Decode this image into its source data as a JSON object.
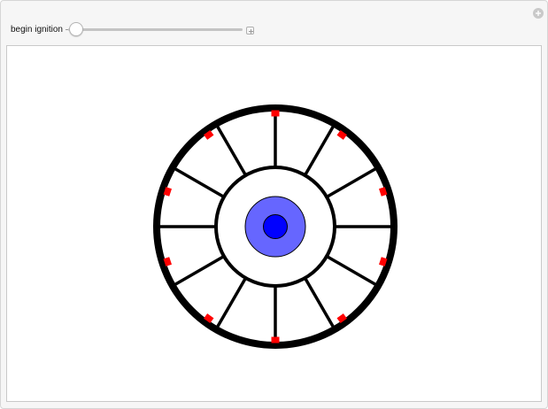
{
  "controls": {
    "slider": {
      "label": "begin ignition",
      "value_fraction": 0.0
    }
  },
  "diagram": {
    "spoke_count": 12,
    "marker_count": 10,
    "colors": {
      "rim": "#000000",
      "spokes": "#000000",
      "markers": "#ff0000",
      "outer_core": "#6666ff",
      "inner_core": "#0000ff"
    }
  },
  "icons": {
    "expand": "plus-icon",
    "options": "gear-icon"
  }
}
